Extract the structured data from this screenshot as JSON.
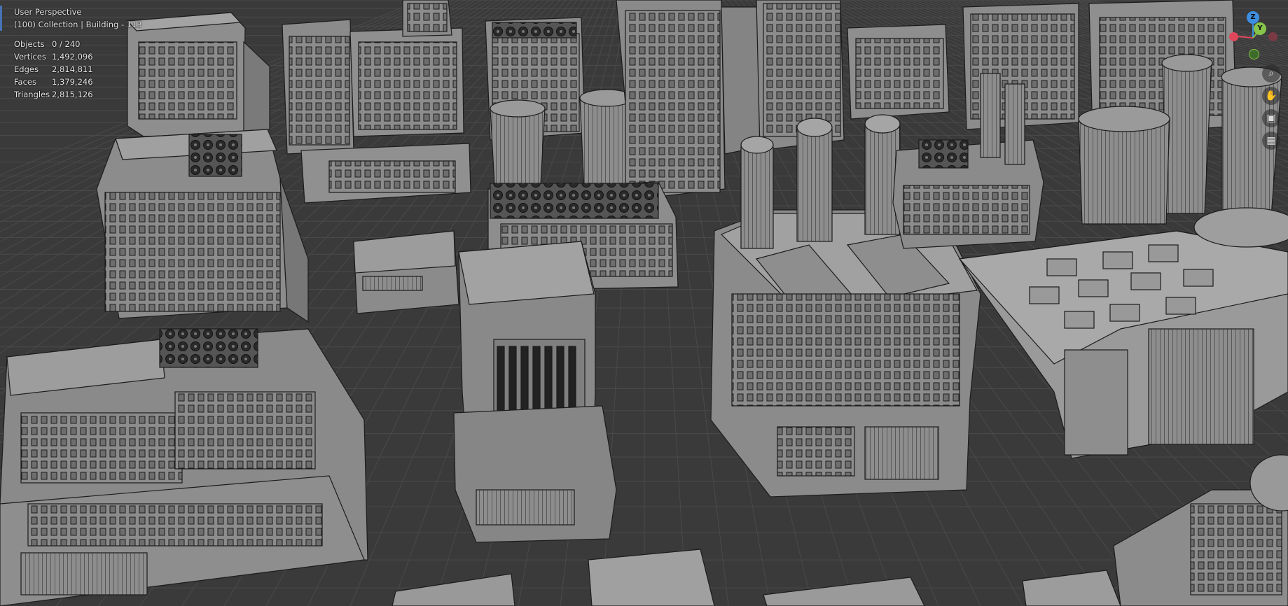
{
  "viewport": {
    "view_name": "User Perspective",
    "collection_info": "(100) Collection | Building - 113",
    "stats": [
      {
        "label": "Objects",
        "value": "0 / 240"
      },
      {
        "label": "Vertices",
        "value": "1,492,096"
      },
      {
        "label": "Edges",
        "value": "2,814,811"
      },
      {
        "label": "Faces",
        "value": "1,379,246"
      },
      {
        "label": "Triangles",
        "value": "2,815,126"
      }
    ]
  },
  "gizmo": {
    "x_label": "X",
    "y_label": "Y",
    "z_label": "Z",
    "colors": {
      "x": "#e0475b",
      "y": "#86c44a",
      "z": "#3d8ee0"
    }
  },
  "nav_buttons": [
    {
      "icon": "zoom-icon"
    },
    {
      "icon": "hand-pan-icon"
    },
    {
      "icon": "camera-icon"
    },
    {
      "icon": "perspective-grid-icon"
    }
  ],
  "colors": {
    "background": "#3a3a3a",
    "grid": "#4a4a4a",
    "building_face": "#8a8a8a",
    "building_roof": "#a0a0a0",
    "wire": "#1c1c1c"
  }
}
